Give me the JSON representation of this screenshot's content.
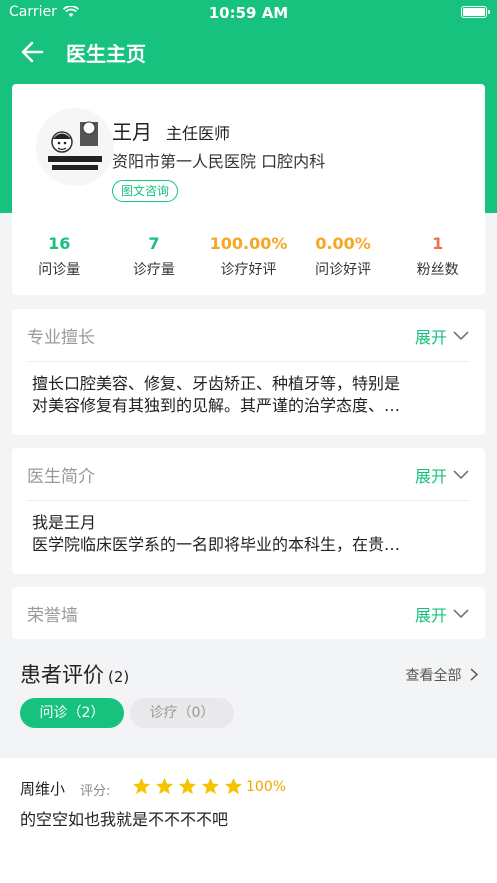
{
  "status_bar": {
    "carrier": "Carrier",
    "time": "10:59 AM"
  },
  "nav": {
    "title": "医生主页",
    "back_icon": "arrow-left-icon"
  },
  "doctor": {
    "name": "王月",
    "title": "主任医师",
    "hospital": "资阳市第一人民医院 口腔内科",
    "tag": "图文咨询"
  },
  "stats": [
    {
      "value": "16",
      "label": "问诊量",
      "color": "#16c27d"
    },
    {
      "value": "7",
      "label": "诊疗量",
      "color": "#16c27d"
    },
    {
      "value": "100.00%",
      "label": "诊疗好评",
      "color": "#f5a623"
    },
    {
      "value": "0.00%",
      "label": "问诊好评",
      "color": "#f5a623"
    },
    {
      "value": "1",
      "label": "粉丝数",
      "color": "#f07050"
    }
  ],
  "sections": {
    "expertise": {
      "title": "专业擅长",
      "expand": "展开",
      "lines": [
        "擅长口腔美容、修复、牙齿矫正、种植牙等，特别是",
        "对美容修复有其独到的见解。其严谨的治学态度、…"
      ]
    },
    "intro": {
      "title": "医生简介",
      "expand": "展开",
      "lines": [
        "我是王月",
        "医学院临床医学系的一名即将毕业的本科生，在贵…"
      ]
    },
    "honor": {
      "title": "荣誉墙",
      "expand": "展开"
    }
  },
  "reviews": {
    "title": "患者评价",
    "count": "(2)",
    "view_all": "查看全部",
    "tabs": [
      "问诊（2）",
      "诊疗（0）"
    ],
    "items": [
      {
        "user": "周维小",
        "score_label": "评分:",
        "stars": 5,
        "percent": "100%",
        "text": "的空空如也我就是不不不不吧"
      }
    ]
  },
  "colors": {
    "accent": "#16c27d",
    "star": "#f5c400"
  }
}
